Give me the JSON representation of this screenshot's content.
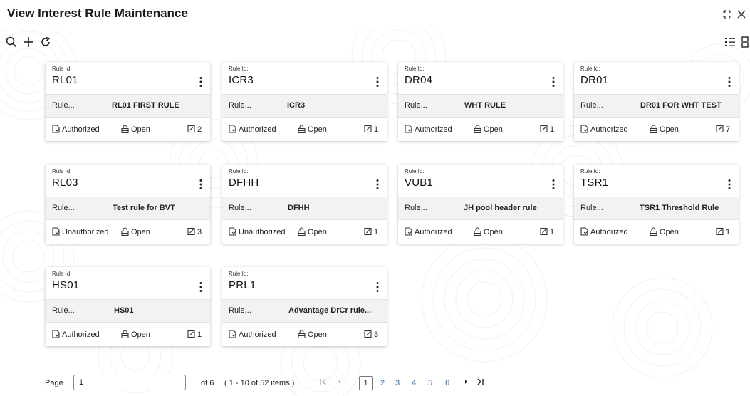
{
  "header": {
    "title": "View Interest Rule Maintenance"
  },
  "cards": [
    {
      "label": "Rule Id:",
      "id": "RL01",
      "desc_key": "Rule...",
      "desc_value": "RL01 FIRST RULE",
      "auth": "Authorized",
      "status": "Open",
      "mods": "2"
    },
    {
      "label": "Rule Id:",
      "id": "ICR3",
      "desc_key": "Rule...",
      "desc_value": "ICR3",
      "auth": "Authorized",
      "status": "Open",
      "mods": "1"
    },
    {
      "label": "Rule Id:",
      "id": "DR04",
      "desc_key": "Rule...",
      "desc_value": "WHT RULE",
      "auth": "Authorized",
      "status": "Open",
      "mods": "1"
    },
    {
      "label": "Rule Id:",
      "id": "DR01",
      "desc_key": "Rule...",
      "desc_value": "DR01 FOR WHT TEST",
      "auth": "Authorized",
      "status": "Open",
      "mods": "7"
    },
    {
      "label": "Rule Id:",
      "id": "RL03",
      "desc_key": "Rule...",
      "desc_value": "Test rule for BVT",
      "auth": "Unauthorized",
      "status": "Open",
      "mods": "3"
    },
    {
      "label": "Rule Id:",
      "id": "DFHH",
      "desc_key": "Rule...",
      "desc_value": "DFHH",
      "auth": "Unauthorized",
      "status": "Open",
      "mods": "1"
    },
    {
      "label": "Rule Id:",
      "id": "VUB1",
      "desc_key": "Rule...",
      "desc_value": "JH pool header rule",
      "auth": "Authorized",
      "status": "Open",
      "mods": "1"
    },
    {
      "label": "Rule Id:",
      "id": "TSR1",
      "desc_key": "Rule...",
      "desc_value": "TSR1 Threshold Rule",
      "auth": "Authorized",
      "status": "Open",
      "mods": "1"
    },
    {
      "label": "Rule Id:",
      "id": "HS01",
      "desc_key": "Rule...",
      "desc_value": "HS01",
      "auth": "Authorized",
      "status": "Open",
      "mods": "1"
    },
    {
      "label": "Rule Id:",
      "id": "PRL1",
      "desc_key": "Rule...",
      "desc_value": "Advantage DrCr rule...",
      "auth": "Authorized",
      "status": "Open",
      "mods": "3"
    }
  ],
  "pager": {
    "page_label": "Page",
    "page_value": "1",
    "of_label": "of 6",
    "range_label": "( 1 - 10 of 52 items )",
    "pages": [
      "1",
      "2",
      "3",
      "4",
      "5",
      "6"
    ]
  }
}
